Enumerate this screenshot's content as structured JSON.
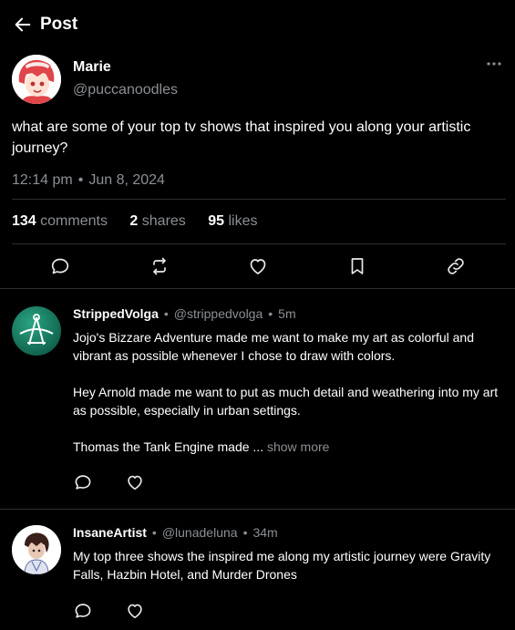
{
  "header": {
    "title": "Post"
  },
  "post": {
    "author_name": "Marie",
    "author_handle": "@puccanoodles",
    "body": "what are some of your top tv shows that inspired you along your artistic journey?",
    "time": "12:14 pm",
    "date": "Jun 8, 2024",
    "stats": {
      "comments_count": "134",
      "comments_label": "comments",
      "shares_count": "2",
      "shares_label": "shares",
      "likes_count": "95",
      "likes_label": "likes"
    }
  },
  "comments": [
    {
      "name": "StrippedVolga",
      "handle": "@strippedvolga",
      "age": "5m",
      "paragraphs": [
        "Jojo's Bizzare Adventure made me want to make my art as colorful and vibrant as possible whenever I chose to draw with colors.",
        "Hey Arnold made me want to put as much detail and weathering into my art as possible, especially in urban settings.",
        "Thomas the Tank Engine made ..."
      ],
      "show_more": "show more"
    },
    {
      "name": "InsaneArtist",
      "handle": "@lunadeluna",
      "age": "34m",
      "paragraphs": [
        "My top three shows the inspired me along my artistic journey were Gravity Falls, Hazbin Hotel, and Murder Drones"
      ]
    }
  ],
  "icons": {
    "back": "arrow-left-icon",
    "more": "more-horizontal-icon",
    "comment": "comment-bubble-icon",
    "repost": "repost-icon",
    "like": "heart-icon",
    "bookmark": "bookmark-icon",
    "share": "link-icon"
  },
  "colors": {
    "background": "#000000",
    "text": "#ffffff",
    "muted": "#8b8f94",
    "divider": "#2b2f33"
  }
}
